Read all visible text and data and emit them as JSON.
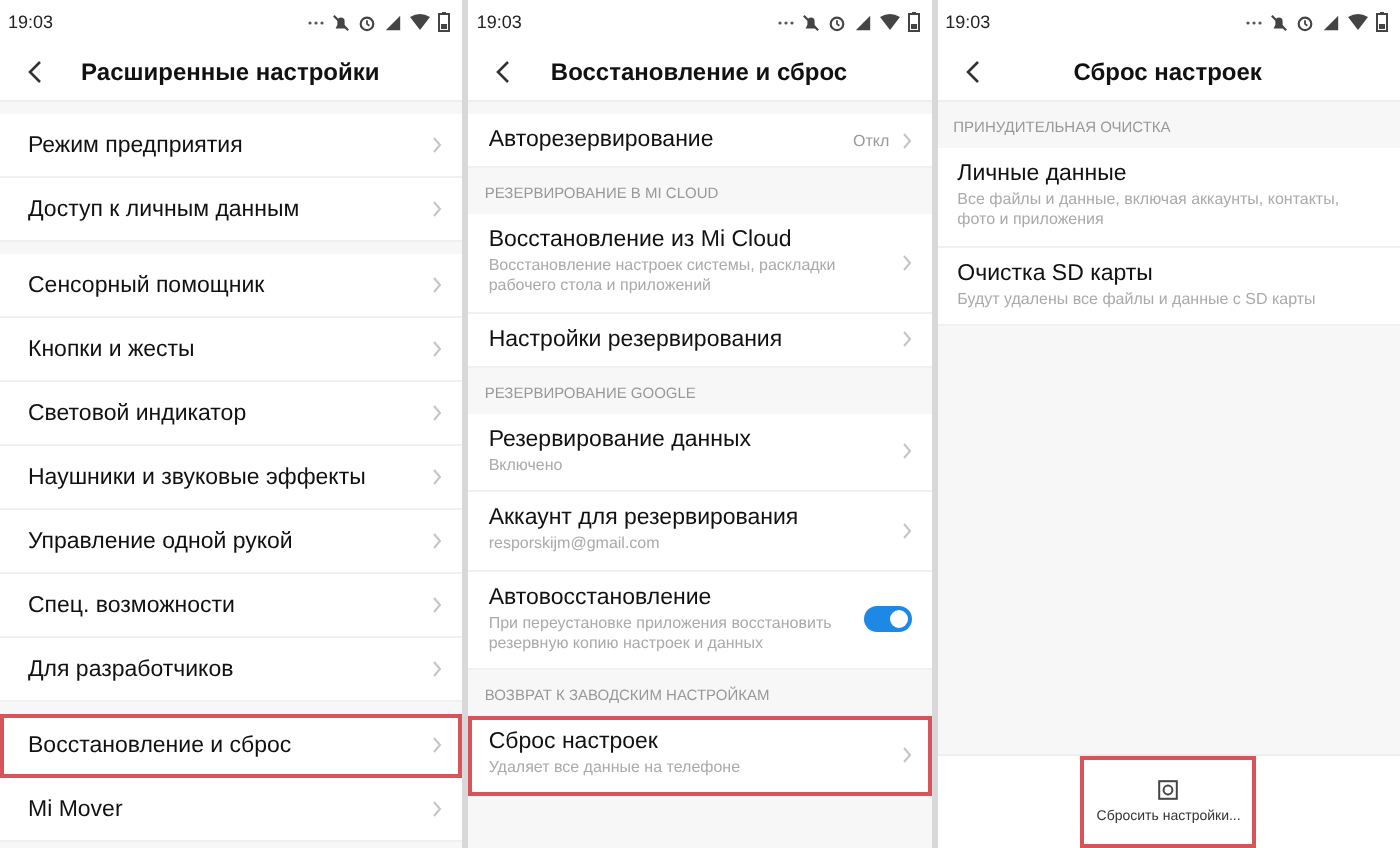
{
  "panels": [
    {
      "time": "19:03",
      "title": "Расширенные настройки",
      "groups": [
        {
          "items": [
            {
              "title": "Режим предприятия",
              "chevron": true,
              "highlighted": false
            },
            {
              "title": "Доступ к личным данным",
              "chevron": true,
              "highlighted": false
            }
          ]
        },
        {
          "items": [
            {
              "title": "Сенсорный помощник",
              "chevron": true,
              "highlighted": false
            },
            {
              "title": "Кнопки и жесты",
              "chevron": true,
              "highlighted": false
            },
            {
              "title": "Световой индикатор",
              "chevron": true,
              "highlighted": false
            },
            {
              "title": "Наушники и звуковые эффекты",
              "chevron": true,
              "highlighted": false
            },
            {
              "title": "Управление одной рукой",
              "chevron": true,
              "highlighted": false
            },
            {
              "title": "Спец. возможности",
              "chevron": true,
              "highlighted": false
            },
            {
              "title": "Для разработчиков",
              "chevron": true,
              "highlighted": false
            }
          ]
        },
        {
          "items": [
            {
              "title": "Восстановление и сброс",
              "chevron": true,
              "highlighted": true
            },
            {
              "title": "Mi Mover",
              "chevron": true,
              "highlighted": false
            }
          ]
        }
      ]
    },
    {
      "time": "19:03",
      "title": "Восстановление и сброс",
      "groups": [
        {
          "items": [
            {
              "title": "Авторезервирование",
              "value": "Откл",
              "chevron": true,
              "highlighted": false
            }
          ]
        },
        {
          "header": "РЕЗЕРВИРОВАНИЕ В MI CLOUD",
          "items": [
            {
              "title": "Восстановление из Mi Cloud",
              "subtitle": "Восстановление настроек системы, раскладки рабочего стола и приложений",
              "chevron": true,
              "highlighted": false
            },
            {
              "title": "Настройки резервирования",
              "chevron": true,
              "highlighted": false
            }
          ]
        },
        {
          "header": "РЕЗЕРВИРОВАНИЕ GOOGLE",
          "items": [
            {
              "title": "Резервирование данных",
              "subtitle": "Включено",
              "chevron": true,
              "highlighted": false
            },
            {
              "title": "Аккаунт для резервирования",
              "subtitle": "resporskijm@gmail.com",
              "chevron": true,
              "highlighted": false
            },
            {
              "title": "Автовосстановление",
              "subtitle": "При переустановке приложения восстановить резервную копию настроек и данных",
              "chevron": false,
              "toggle": {
                "on": true
              },
              "highlighted": false
            }
          ]
        },
        {
          "header": "ВОЗВРАТ К ЗАВОДСКИМ НАСТРОЙКАМ",
          "items": [
            {
              "title": "Сброс настроек",
              "subtitle": "Удаляет все данные на телефоне",
              "chevron": true,
              "highlighted": true
            }
          ]
        }
      ]
    },
    {
      "time": "19:03",
      "title": "Сброс настроек",
      "groups": [
        {
          "header": "ПРИНУДИТЕЛЬНАЯ ОЧИСТКА",
          "items": [
            {
              "title": "Личные данные",
              "subtitle": "Все файлы и данные, включая аккаунты, контакты, фото и приложения",
              "chevron": false,
              "highlighted": false
            },
            {
              "title": "Очистка SD карты",
              "subtitle": "Будут удалены все файлы и данные с SD карты",
              "chevron": false,
              "highlighted": false
            }
          ]
        }
      ],
      "bottom_button": {
        "label": "Сбросить настройки...",
        "highlighted": true
      }
    }
  ]
}
